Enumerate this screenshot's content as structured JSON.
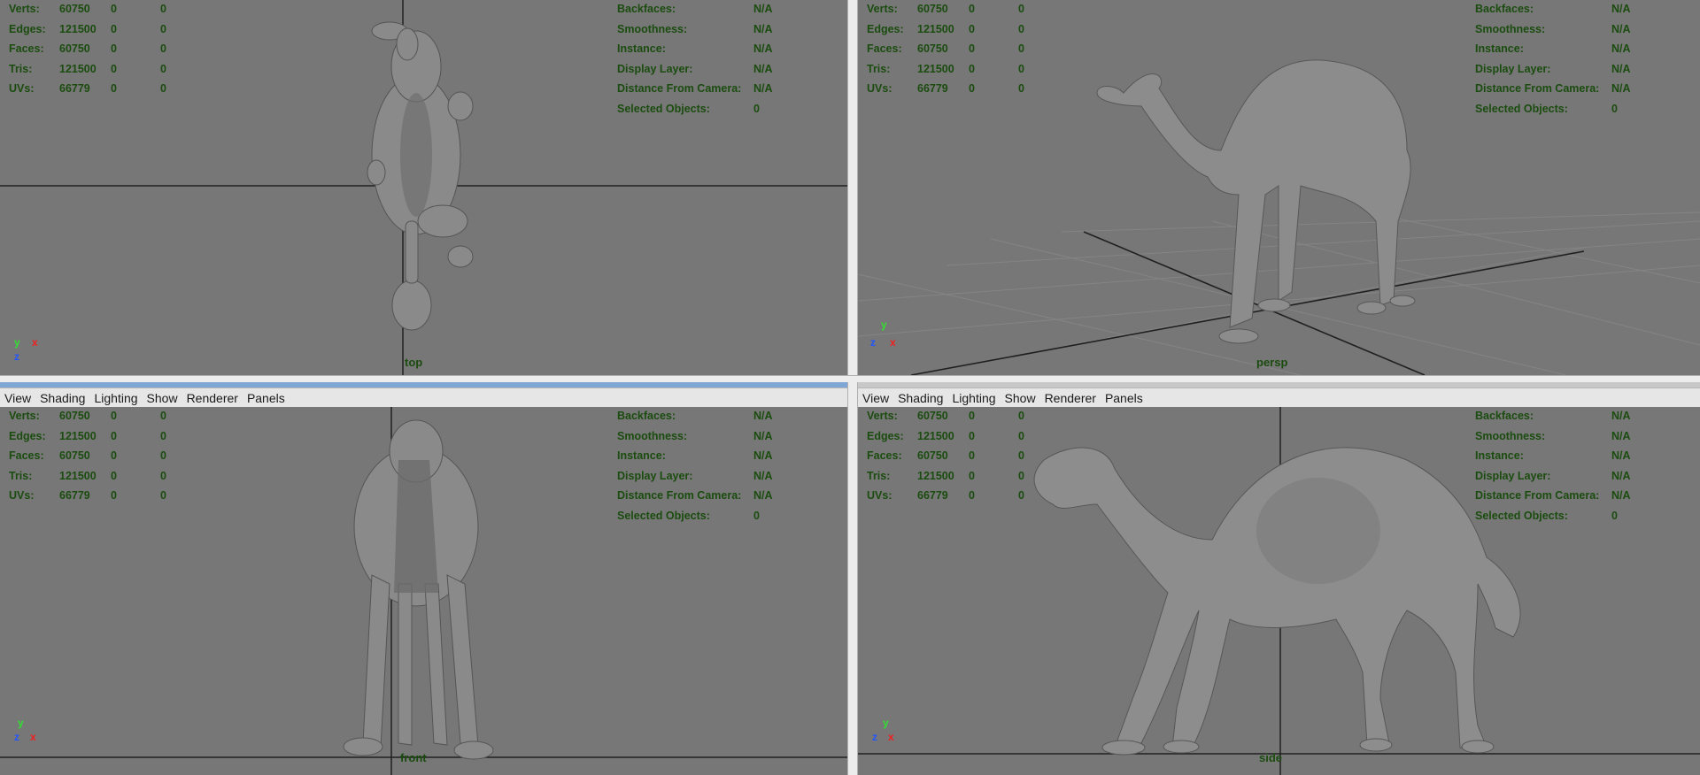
{
  "menu": [
    "View",
    "Shading",
    "Lighting",
    "Show",
    "Renderer",
    "Panels"
  ],
  "hud_left": [
    {
      "label": "Verts:",
      "v1": "60750",
      "v2": "0",
      "v3": "0"
    },
    {
      "label": "Edges:",
      "v1": "121500",
      "v2": "0",
      "v3": "0"
    },
    {
      "label": "Faces:",
      "v1": "60750",
      "v2": "0",
      "v3": "0"
    },
    {
      "label": "Tris:",
      "v1": "121500",
      "v2": "0",
      "v3": "0"
    },
    {
      "label": "UVs:",
      "v1": "66779",
      "v2": "0",
      "v3": "0"
    }
  ],
  "hud_right": [
    {
      "label": "Backfaces:",
      "value": "N/A"
    },
    {
      "label": "Smoothness:",
      "value": "N/A"
    },
    {
      "label": "Instance:",
      "value": "N/A"
    },
    {
      "label": "Display Layer:",
      "value": "N/A"
    },
    {
      "label": "Distance From Camera:",
      "value": "N/A"
    },
    {
      "label": "Selected Objects:",
      "value": "0"
    }
  ],
  "viewports": {
    "top": {
      "camera": "top",
      "axis": {
        "a": "y",
        "b": "x",
        "c": "z"
      }
    },
    "persp": {
      "camera": "persp",
      "axis": {
        "a": "y",
        "b": "x",
        "c": "z"
      }
    },
    "front": {
      "camera": "front",
      "axis": {
        "a": "y",
        "b": "x",
        "c": "z"
      }
    },
    "side": {
      "camera": "side",
      "axis": {
        "a": "y",
        "b": "x",
        "c": "z"
      }
    }
  },
  "colors": {
    "viewport_bg": "#777777",
    "hud_text": "#1b4c0f",
    "model": "#8e8e8e",
    "axis_x": "#ee2222",
    "axis_y": "#33dd33",
    "axis_z": "#2255ff"
  },
  "icons": [
    "axis-gizmo-icon"
  ]
}
